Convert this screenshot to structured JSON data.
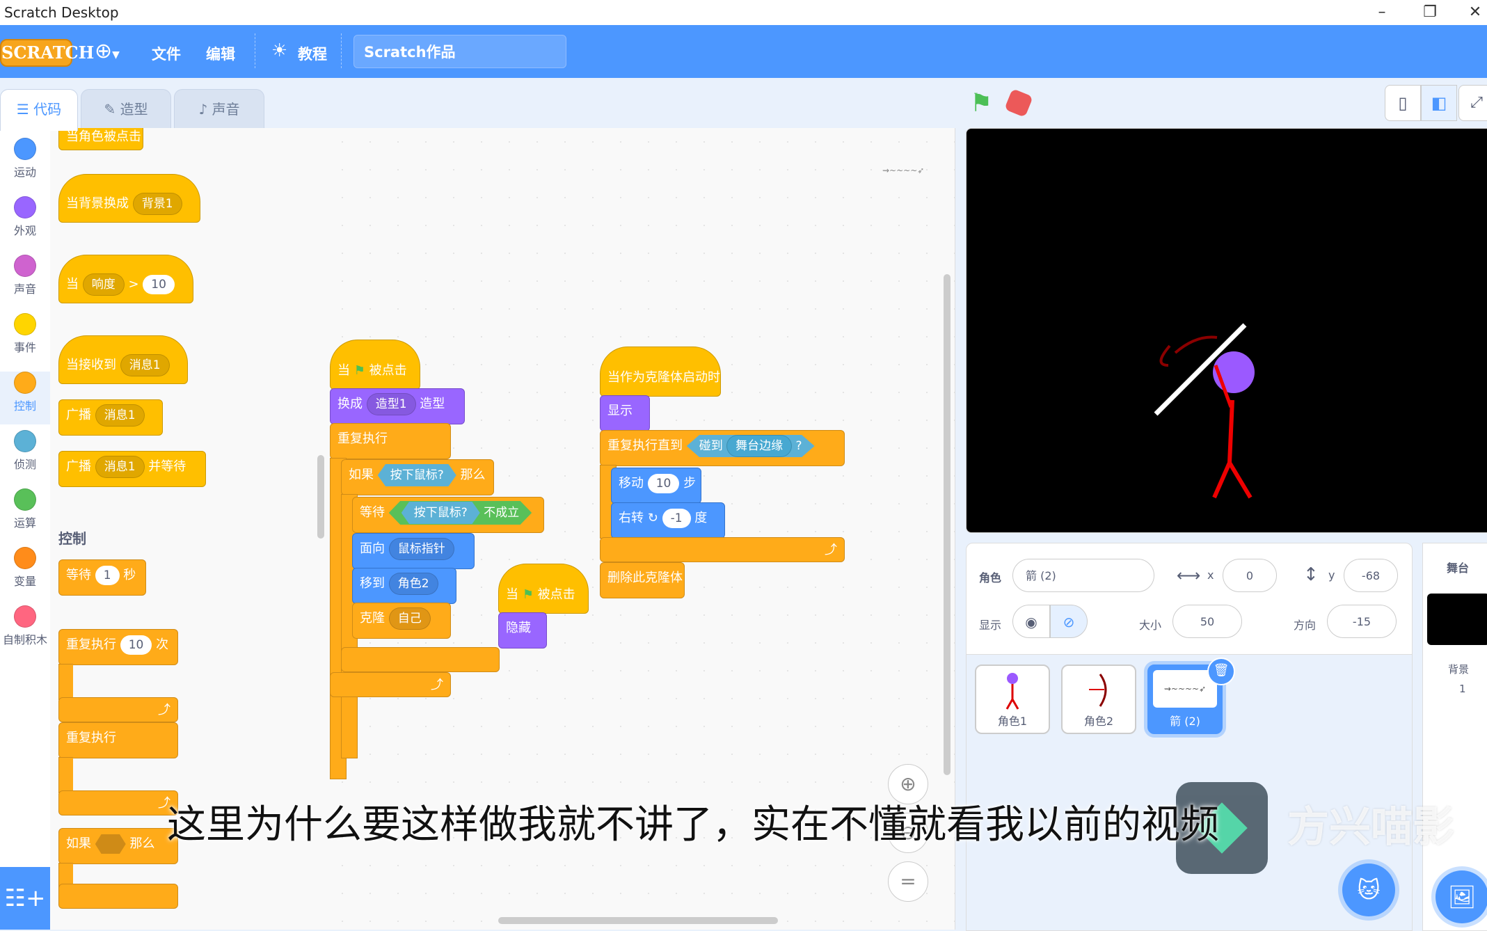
{
  "window": {
    "title": "Scratch Desktop"
  },
  "menubar": {
    "logo": "SCRATCH",
    "file": "文件",
    "edit": "编辑",
    "tutorials": "教程",
    "project_title": "Scratch作品"
  },
  "tabs": {
    "code": "代码",
    "costumes": "造型",
    "sounds": "声音"
  },
  "categories": [
    {
      "label": "运动",
      "color": "#4c97ff"
    },
    {
      "label": "外观",
      "color": "#9966ff"
    },
    {
      "label": "声音",
      "color": "#cf63cf"
    },
    {
      "label": "事件",
      "color": "#ffd500"
    },
    {
      "label": "控制",
      "color": "#ffab19"
    },
    {
      "label": "侦测",
      "color": "#5cb1d6"
    },
    {
      "label": "运算",
      "color": "#59c059"
    },
    {
      "label": "变量",
      "color": "#ff8c1a"
    },
    {
      "label": "自制积木",
      "color": "#ff6680"
    }
  ],
  "palette": {
    "sprite_clicked": "当角色被点击",
    "backdrop_switch": "当背景换成",
    "backdrop1": "背景1",
    "when": "当",
    "loudness": "响度",
    "gt": ">",
    "gt_val": "10",
    "receive": "当接收到",
    "msg1": "消息1",
    "broadcast": "广播",
    "broadcast_wait": "并等待",
    "section_control": "控制",
    "wait": "等待",
    "wait_val": "1",
    "seconds": "秒",
    "repeat": "重复执行",
    "repeat_val": "10",
    "times": "次",
    "forever": "重复执行",
    "if": "如果",
    "then": "那么"
  },
  "script1": {
    "when": "当",
    "clicked": "被点击",
    "switch": "换成",
    "costume1": "造型1",
    "costume": "造型",
    "forever": "重复执行",
    "if": "如果",
    "mouse_down": "按下鼠标?",
    "then": "那么",
    "wait": "等待",
    "not_hold": "不成立",
    "point": "面向",
    "mouse_pointer": "鼠标指针",
    "goto": "移到",
    "sprite2": "角色2",
    "clone": "克隆",
    "myself": "自己"
  },
  "script2": {
    "when": "当",
    "clicked": "被点击",
    "hide": "隐藏"
  },
  "script3": {
    "clone_start": "当作为克隆体启动时",
    "show": "显示",
    "repeat_until": "重复执行直到",
    "touching": "碰到",
    "edge": "舞台边缘",
    "q": "?",
    "move": "移动",
    "move_val": "10",
    "steps": "步",
    "turn": "右转",
    "turn_val": "-1",
    "deg": "度",
    "delete_clone": "删除此克隆体"
  },
  "sprite_info": {
    "sprite_label": "角色",
    "sprite_name": "箭 (2)",
    "x_label": "x",
    "x": "0",
    "y_label": "y",
    "y": "-68",
    "show_label": "显示",
    "size_label": "大小",
    "size": "50",
    "dir_label": "方向",
    "dir": "-15"
  },
  "sprites": [
    {
      "name": "角色1"
    },
    {
      "name": "角色2"
    },
    {
      "name": "箭 (2)"
    }
  ],
  "stage_panel": {
    "title": "舞台",
    "backdrop_label": "背景",
    "backdrop_count": "1"
  },
  "overlay": {
    "subtitle": "这里为什么要这样做我就不讲了，实在不懂就看我以前的视频",
    "watermark": "方兴喵影"
  },
  "colors": {
    "accent": "#4c97ff",
    "events": "#ffbf00",
    "control": "#ffab19"
  }
}
